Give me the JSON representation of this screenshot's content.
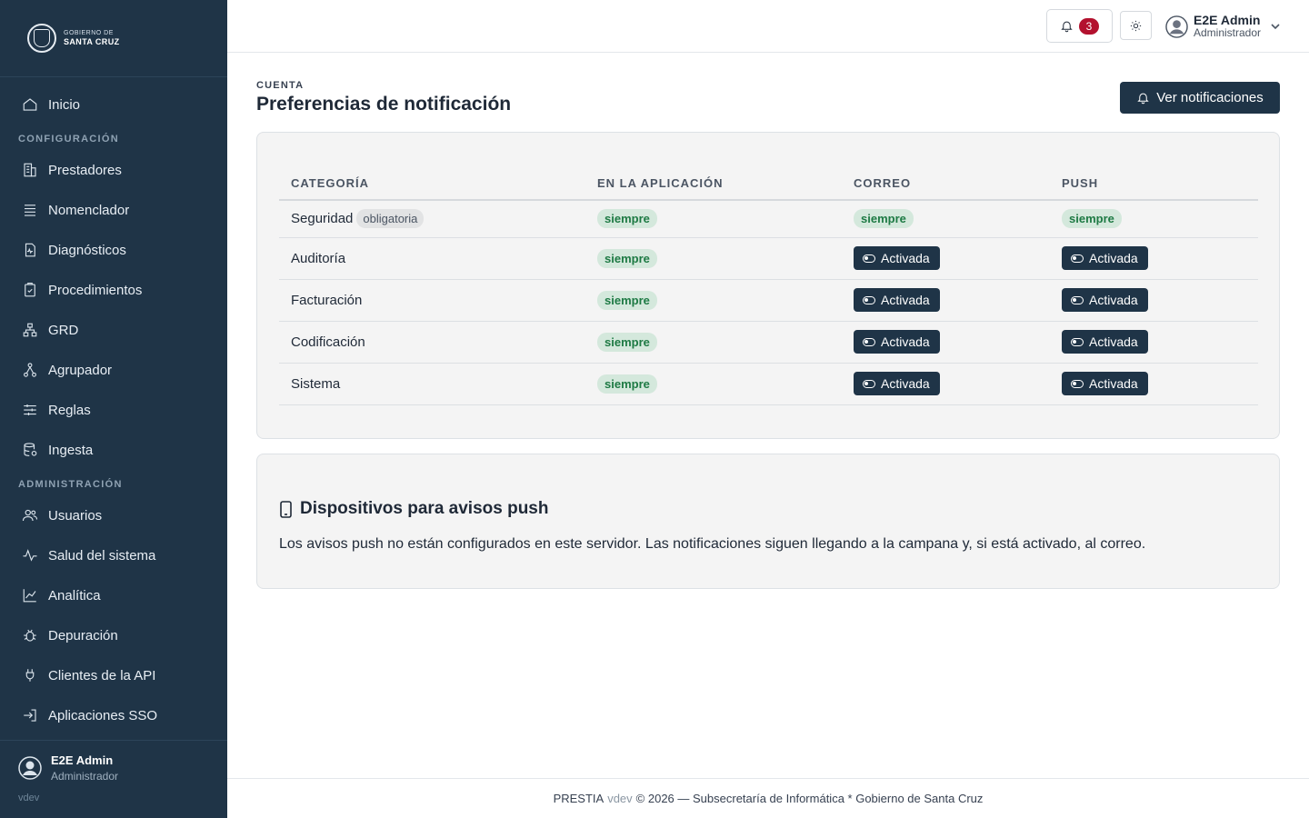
{
  "brand": {
    "logo_line1": "GOBIERNO DE",
    "logo_line2": "SANTA CRUZ"
  },
  "sidebar": {
    "items": [
      {
        "label": "Inicio",
        "icon": "home-icon"
      },
      {
        "section": "CONFIGURACIÓN"
      },
      {
        "label": "Prestadores",
        "icon": "building-icon"
      },
      {
        "label": "Nomenclador",
        "icon": "list-icon"
      },
      {
        "label": "Diagnósticos",
        "icon": "file-pulse-icon"
      },
      {
        "label": "Procedimientos",
        "icon": "clipboard-check-icon"
      },
      {
        "label": "GRD",
        "icon": "hierarchy-icon"
      },
      {
        "label": "Agrupador",
        "icon": "diagram-icon"
      },
      {
        "label": "Reglas",
        "icon": "sliders-icon"
      },
      {
        "label": "Ingesta",
        "icon": "database-icon"
      },
      {
        "section": "ADMINISTRACIÓN"
      },
      {
        "label": "Usuarios",
        "icon": "users-icon"
      },
      {
        "label": "Salud del sistema",
        "icon": "activity-icon"
      },
      {
        "label": "Analítica",
        "icon": "line-chart-icon"
      },
      {
        "label": "Depuración",
        "icon": "bug-icon"
      },
      {
        "label": "Clientes de la API",
        "icon": "plug-icon"
      },
      {
        "label": "Aplicaciones SSO",
        "icon": "login-icon"
      }
    ],
    "user": {
      "name": "E2E Admin",
      "role": "Administrador",
      "version": "vdev"
    }
  },
  "topbar": {
    "notification_count": "3",
    "user_name": "E2E Admin",
    "user_role": "Administrador"
  },
  "page": {
    "eyebrow": "CUENTA",
    "title": "Preferencias de notificación",
    "action_label": "Ver notificaciones"
  },
  "table": {
    "headers": [
      "CATEGORÍA",
      "EN LA APLICACIÓN",
      "CORREO",
      "PUSH"
    ],
    "rows": [
      {
        "category": "Seguridad",
        "tag": "obligatoria",
        "in_app": "siempre",
        "email": "siempre",
        "push": "siempre"
      },
      {
        "category": "Auditoría",
        "in_app": "siempre",
        "email": "Activada",
        "push": "Activada"
      },
      {
        "category": "Facturación",
        "in_app": "siempre",
        "email": "Activada",
        "push": "Activada"
      },
      {
        "category": "Codificación",
        "in_app": "siempre",
        "email": "Activada",
        "push": "Activada"
      },
      {
        "category": "Sistema",
        "in_app": "siempre",
        "email": "Activada",
        "push": "Activada"
      }
    ]
  },
  "devices": {
    "title": "Dispositivos para avisos push",
    "text": "Los avisos push no están configurados en este servidor. Las notificaciones siguen llegando a la campana y, si está activado, al correo."
  },
  "footer": {
    "brand": "PRESTIA",
    "version": "vdev",
    "text": "© 2026 — Subsecretaría de Informática * Gobierno de Santa Cruz"
  },
  "colors": {
    "sidebar": "#1f3447",
    "accent": "#1f3447",
    "badge": "#b3112e",
    "success_pill": "#d4e8dc"
  }
}
